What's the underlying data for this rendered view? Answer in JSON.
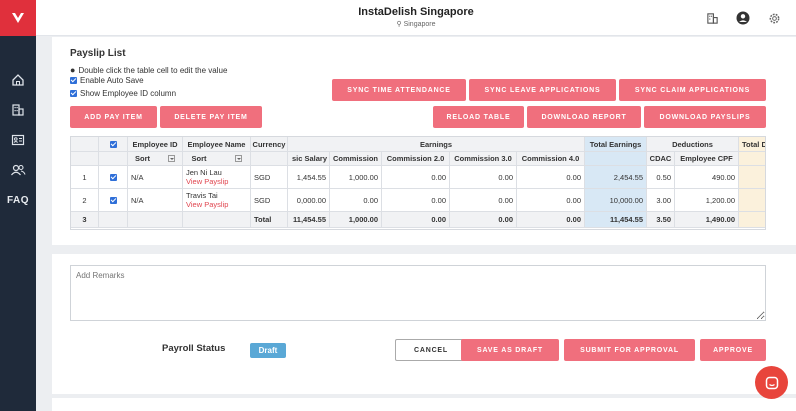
{
  "app": {
    "title": "InstaDelish Singapore",
    "location": "Singapore"
  },
  "colors": {
    "accent": "#f06f7d",
    "sidebar": "#1f2a3a",
    "brand": "#e0303c",
    "draft_badge": "#5aa8d6"
  },
  "sidebar": {
    "items": [
      {
        "icon": "home-icon"
      },
      {
        "icon": "building-icon"
      },
      {
        "icon": "id-card-icon"
      },
      {
        "icon": "users-icon"
      },
      {
        "label": "FAQ"
      }
    ]
  },
  "header": {
    "icons": [
      "building-icon",
      "user-icon",
      "gear-icon"
    ]
  },
  "payslip": {
    "title": "Payslip List",
    "hint": "Double click the table cell to edit the value",
    "auto_save": "Enable Auto Save",
    "show_id": "Show Employee ID column"
  },
  "buttons": {
    "sync_time": "Sync Time Attendance",
    "sync_leave": "Sync Leave Applications",
    "sync_claim": "Sync Claim Applications",
    "add_pay": "Add Pay Item",
    "delete_pay": "Delete Pay Item",
    "reload": "Reload Table",
    "download_report": "Download Report",
    "download_payslips": "Download Payslips"
  },
  "table": {
    "group_headers": {
      "earnings": "Earnings",
      "total_earnings": "Total Earnings",
      "deductions": "Deductions",
      "total_d": "Total D"
    },
    "headers": {
      "employee_id": "Employee ID",
      "employee_name": "Employee Name",
      "currency": "Currency",
      "basic_salary": "sic Salary",
      "commission": "Commission",
      "commission2": "Commission 2.0",
      "commission3": "Commission 3.0",
      "commission4": "Commission 4.0",
      "cdac": "CDAC",
      "employee_cpf": "Employee CPF"
    },
    "sort_label": "Sort",
    "rows": [
      {
        "no": "1",
        "employee_id": "N/A",
        "name": "Jen Ni Lau",
        "link": "View Payslip",
        "currency": "SGD",
        "basic": "1,454.55",
        "commission": "1,000.00",
        "c2": "0.00",
        "c3": "0.00",
        "c4": "0.00",
        "total": "2,454.55",
        "cdac": "0.50",
        "cpf": "490.00"
      },
      {
        "no": "2",
        "employee_id": "N/A",
        "name": "Travis Tai",
        "link": "View Payslip",
        "currency": "SGD",
        "basic": "0,000.00",
        "commission": "0.00",
        "c2": "0.00",
        "c3": "0.00",
        "c4": "0.00",
        "total": "10,000.00",
        "cdac": "3.00",
        "cpf": "1,200.00"
      }
    ],
    "totals": {
      "no": "3",
      "label": "Total",
      "basic": "11,454.55",
      "commission": "1,000.00",
      "c2": "0.00",
      "c3": "0.00",
      "c4": "0.00",
      "total": "11,454.55",
      "cdac": "3.50",
      "cpf": "1,490.00"
    }
  },
  "remarks": {
    "placeholder": "Add Remarks"
  },
  "status": {
    "label": "Payroll Status",
    "value": "Draft"
  },
  "actions": {
    "cancel": "Cancel",
    "save_draft": "Save as Draft",
    "submit": "Submit for Approval",
    "approve": "Approve"
  }
}
